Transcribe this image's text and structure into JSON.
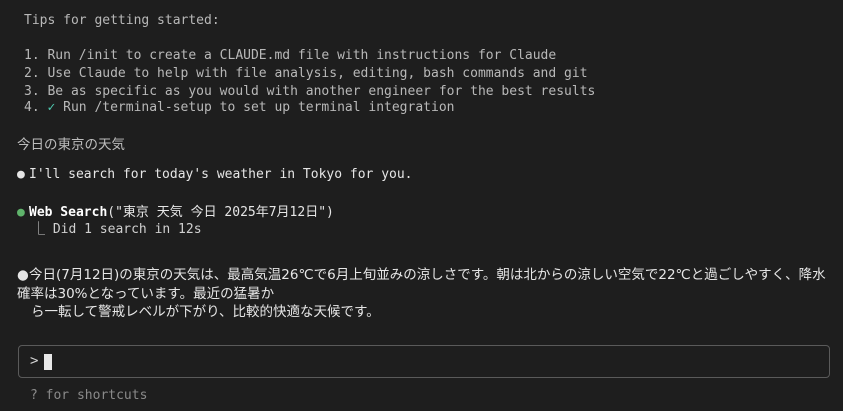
{
  "tips": {
    "title": "Tips for getting started:",
    "items": [
      "1. Run /init to create a CLAUDE.md file with instructions for Claude",
      "2. Use Claude to help with file analysis, editing, bash commands and git",
      "3. Be as specific as you would with another engineer for the best results"
    ],
    "item4_prefix": "4. ",
    "item4_check": "✓",
    "item4_text": " Run /terminal-setup to set up terminal integration"
  },
  "conversation": {
    "user_prompt": "今日の東京の天気",
    "assistant_intro": "I'll search for today's weather in Tokyo for you.",
    "tool_call": {
      "name": "Web Search",
      "args": "(\"東京 天気 今日 2025年7月12日\")",
      "result": "⎿ Did 1 search in 12s"
    },
    "answer_lines": [
      "今日(7月12日)の東京の天気は、最高気温26℃で6月上旬並みの涼しさです。朝は北からの涼しい空気で22℃と過ごしやすく、降水",
      "確率は30%となっています。最近の猛暑か",
      "ら一転して警戒レベルが下がり、比較的快適な天候です。"
    ],
    "bullet": "●"
  },
  "input": {
    "prompt_symbol": ">",
    "value": ""
  },
  "footer": {
    "shortcuts_hint": "? for shortcuts"
  },
  "colors": {
    "background": "#1e1e1e",
    "tool_bullet": "#5fb36b",
    "check": "#4ec9b0"
  }
}
